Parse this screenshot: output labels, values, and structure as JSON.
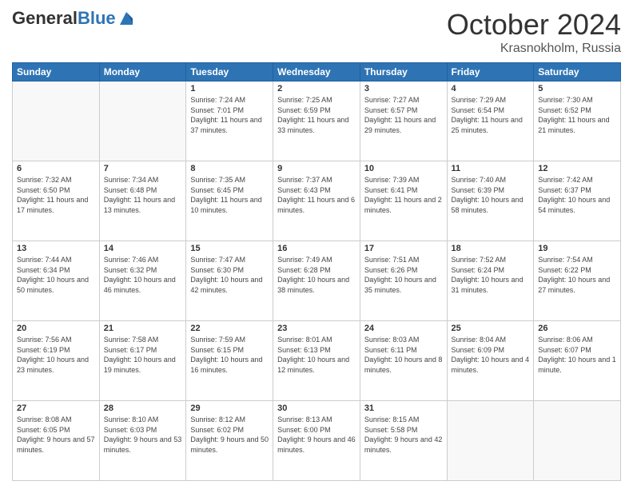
{
  "header": {
    "logo_general": "General",
    "logo_blue": "Blue",
    "month_title": "October 2024",
    "location": "Krasnokholm, Russia"
  },
  "days_of_week": [
    "Sunday",
    "Monday",
    "Tuesday",
    "Wednesday",
    "Thursday",
    "Friday",
    "Saturday"
  ],
  "weeks": [
    [
      {
        "day": "",
        "info": ""
      },
      {
        "day": "",
        "info": ""
      },
      {
        "day": "1",
        "info": "Sunrise: 7:24 AM\nSunset: 7:01 PM\nDaylight: 11 hours and 37 minutes."
      },
      {
        "day": "2",
        "info": "Sunrise: 7:25 AM\nSunset: 6:59 PM\nDaylight: 11 hours and 33 minutes."
      },
      {
        "day": "3",
        "info": "Sunrise: 7:27 AM\nSunset: 6:57 PM\nDaylight: 11 hours and 29 minutes."
      },
      {
        "day": "4",
        "info": "Sunrise: 7:29 AM\nSunset: 6:54 PM\nDaylight: 11 hours and 25 minutes."
      },
      {
        "day": "5",
        "info": "Sunrise: 7:30 AM\nSunset: 6:52 PM\nDaylight: 11 hours and 21 minutes."
      }
    ],
    [
      {
        "day": "6",
        "info": "Sunrise: 7:32 AM\nSunset: 6:50 PM\nDaylight: 11 hours and 17 minutes."
      },
      {
        "day": "7",
        "info": "Sunrise: 7:34 AM\nSunset: 6:48 PM\nDaylight: 11 hours and 13 minutes."
      },
      {
        "day": "8",
        "info": "Sunrise: 7:35 AM\nSunset: 6:45 PM\nDaylight: 11 hours and 10 minutes."
      },
      {
        "day": "9",
        "info": "Sunrise: 7:37 AM\nSunset: 6:43 PM\nDaylight: 11 hours and 6 minutes."
      },
      {
        "day": "10",
        "info": "Sunrise: 7:39 AM\nSunset: 6:41 PM\nDaylight: 11 hours and 2 minutes."
      },
      {
        "day": "11",
        "info": "Sunrise: 7:40 AM\nSunset: 6:39 PM\nDaylight: 10 hours and 58 minutes."
      },
      {
        "day": "12",
        "info": "Sunrise: 7:42 AM\nSunset: 6:37 PM\nDaylight: 10 hours and 54 minutes."
      }
    ],
    [
      {
        "day": "13",
        "info": "Sunrise: 7:44 AM\nSunset: 6:34 PM\nDaylight: 10 hours and 50 minutes."
      },
      {
        "day": "14",
        "info": "Sunrise: 7:46 AM\nSunset: 6:32 PM\nDaylight: 10 hours and 46 minutes."
      },
      {
        "day": "15",
        "info": "Sunrise: 7:47 AM\nSunset: 6:30 PM\nDaylight: 10 hours and 42 minutes."
      },
      {
        "day": "16",
        "info": "Sunrise: 7:49 AM\nSunset: 6:28 PM\nDaylight: 10 hours and 38 minutes."
      },
      {
        "day": "17",
        "info": "Sunrise: 7:51 AM\nSunset: 6:26 PM\nDaylight: 10 hours and 35 minutes."
      },
      {
        "day": "18",
        "info": "Sunrise: 7:52 AM\nSunset: 6:24 PM\nDaylight: 10 hours and 31 minutes."
      },
      {
        "day": "19",
        "info": "Sunrise: 7:54 AM\nSunset: 6:22 PM\nDaylight: 10 hours and 27 minutes."
      }
    ],
    [
      {
        "day": "20",
        "info": "Sunrise: 7:56 AM\nSunset: 6:19 PM\nDaylight: 10 hours and 23 minutes."
      },
      {
        "day": "21",
        "info": "Sunrise: 7:58 AM\nSunset: 6:17 PM\nDaylight: 10 hours and 19 minutes."
      },
      {
        "day": "22",
        "info": "Sunrise: 7:59 AM\nSunset: 6:15 PM\nDaylight: 10 hours and 16 minutes."
      },
      {
        "day": "23",
        "info": "Sunrise: 8:01 AM\nSunset: 6:13 PM\nDaylight: 10 hours and 12 minutes."
      },
      {
        "day": "24",
        "info": "Sunrise: 8:03 AM\nSunset: 6:11 PM\nDaylight: 10 hours and 8 minutes."
      },
      {
        "day": "25",
        "info": "Sunrise: 8:04 AM\nSunset: 6:09 PM\nDaylight: 10 hours and 4 minutes."
      },
      {
        "day": "26",
        "info": "Sunrise: 8:06 AM\nSunset: 6:07 PM\nDaylight: 10 hours and 1 minute."
      }
    ],
    [
      {
        "day": "27",
        "info": "Sunrise: 8:08 AM\nSunset: 6:05 PM\nDaylight: 9 hours and 57 minutes."
      },
      {
        "day": "28",
        "info": "Sunrise: 8:10 AM\nSunset: 6:03 PM\nDaylight: 9 hours and 53 minutes."
      },
      {
        "day": "29",
        "info": "Sunrise: 8:12 AM\nSunset: 6:02 PM\nDaylight: 9 hours and 50 minutes."
      },
      {
        "day": "30",
        "info": "Sunrise: 8:13 AM\nSunset: 6:00 PM\nDaylight: 9 hours and 46 minutes."
      },
      {
        "day": "31",
        "info": "Sunrise: 8:15 AM\nSunset: 5:58 PM\nDaylight: 9 hours and 42 minutes."
      },
      {
        "day": "",
        "info": ""
      },
      {
        "day": "",
        "info": ""
      }
    ]
  ]
}
